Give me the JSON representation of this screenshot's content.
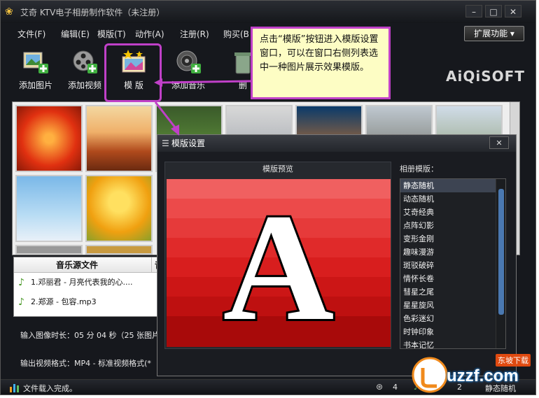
{
  "window": {
    "title": "艾奇 KTV电子相册制作软件（未注册）",
    "min": "–",
    "max": "□",
    "close": "✕"
  },
  "menu": {
    "items": [
      "文件(F)",
      "编辑(E)",
      "模版(T)",
      "动作(A)",
      "注册(R)",
      "购买(B"
    ],
    "extend": "扩展功能"
  },
  "toolbar": {
    "add_image": "添加图片",
    "add_video": "添加视频",
    "template": "模 版",
    "add_music": "添加音乐",
    "delete_partial": "删"
  },
  "brand": "AiQiSOFT",
  "callout": {
    "text": "点击“模版”按钮进入模版设置窗口，可以在窗口右侧列表选中一种图片展示效果模版。"
  },
  "music": {
    "header_col1": "音乐源文件",
    "header_col2": "音",
    "rows": [
      "1.邓丽君 - 月亮代表我的心....",
      "2.郑源 - 包容.mp3"
    ]
  },
  "info": {
    "duration": "输入图像时长：05 分 04 秒（25 张图片",
    "format": "输出视频格式：MP4 - 标准视频格式(*"
  },
  "status": {
    "text": "文件载入完成。",
    "count1": "4",
    "count2": "2",
    "template_name": "静态随机"
  },
  "dialog": {
    "title": "模版设置",
    "close": "✕",
    "preview_label": "模版预览",
    "preview_letter": "A",
    "list_label": "相册模版：",
    "templates": [
      "静态随机",
      "动态随机",
      "艾奇经典",
      "点阵幻影",
      "变形金刚",
      "趣味漫游",
      "斑驳破碎",
      "情怀长卷",
      "彗星之尾",
      "星星旋风",
      "色彩迷幻",
      "时钟印象",
      "书本记忆"
    ],
    "selected": 0
  },
  "watermark": {
    "brand": "uzzf.com",
    "tag": "东坡下载"
  },
  "colors": {
    "accent": "#c040c8",
    "callout_bg": "#fdfdc4",
    "preview_red": "#e41f1f",
    "selection": "#3d4452"
  }
}
